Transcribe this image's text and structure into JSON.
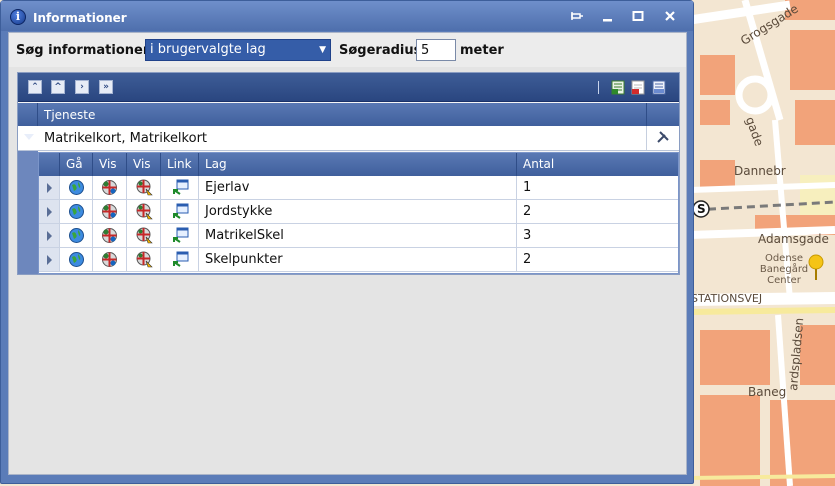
{
  "window": {
    "title": "Informationer",
    "controls": [
      "pin",
      "minimize",
      "maximize",
      "close"
    ]
  },
  "search": {
    "label": "Søg informationer",
    "dropdown_value": "i brugervalgte lag",
    "radius_label": "Søgeradius",
    "radius_value": "5",
    "unit_label": "meter"
  },
  "toolbar": {
    "nav_buttons": [
      "collapse-all-icon",
      "collapse-icon",
      "expand-icon",
      "expand-all-icon"
    ],
    "tools": [
      "excel-export-icon",
      "pdf-export-icon",
      "print-icon"
    ]
  },
  "grid": {
    "column_header": "Tjeneste",
    "service": {
      "label": "Matrikelkort, Matrikelkort"
    },
    "layer_columns": {
      "go": "Gå",
      "show1": "Vis",
      "show2": "Vis",
      "link": "Link",
      "layer": "Lag",
      "count": "Antal"
    },
    "rows": [
      {
        "layer": "Ejerlav",
        "count": "1"
      },
      {
        "layer": "Jordstykke",
        "count": "2"
      },
      {
        "layer": "MatrikelSkel",
        "count": "3"
      },
      {
        "layer": "Skelpunkter",
        "count": "2"
      }
    ]
  },
  "map": {
    "labels": {
      "street1": "Grogsgade",
      "street2": "Dannebr",
      "street3": "Adamsgade",
      "street4": "STATIONSVEJ",
      "street5": "ardspladsen",
      "street6": "Odense Banegård Center",
      "street7": "Baneg",
      "street8": "gade"
    },
    "station_marker": "S"
  },
  "colors": {
    "titlebar": "#5b7cb8",
    "grid_header": "#3f5f9c",
    "dropdown": "#355da8"
  }
}
